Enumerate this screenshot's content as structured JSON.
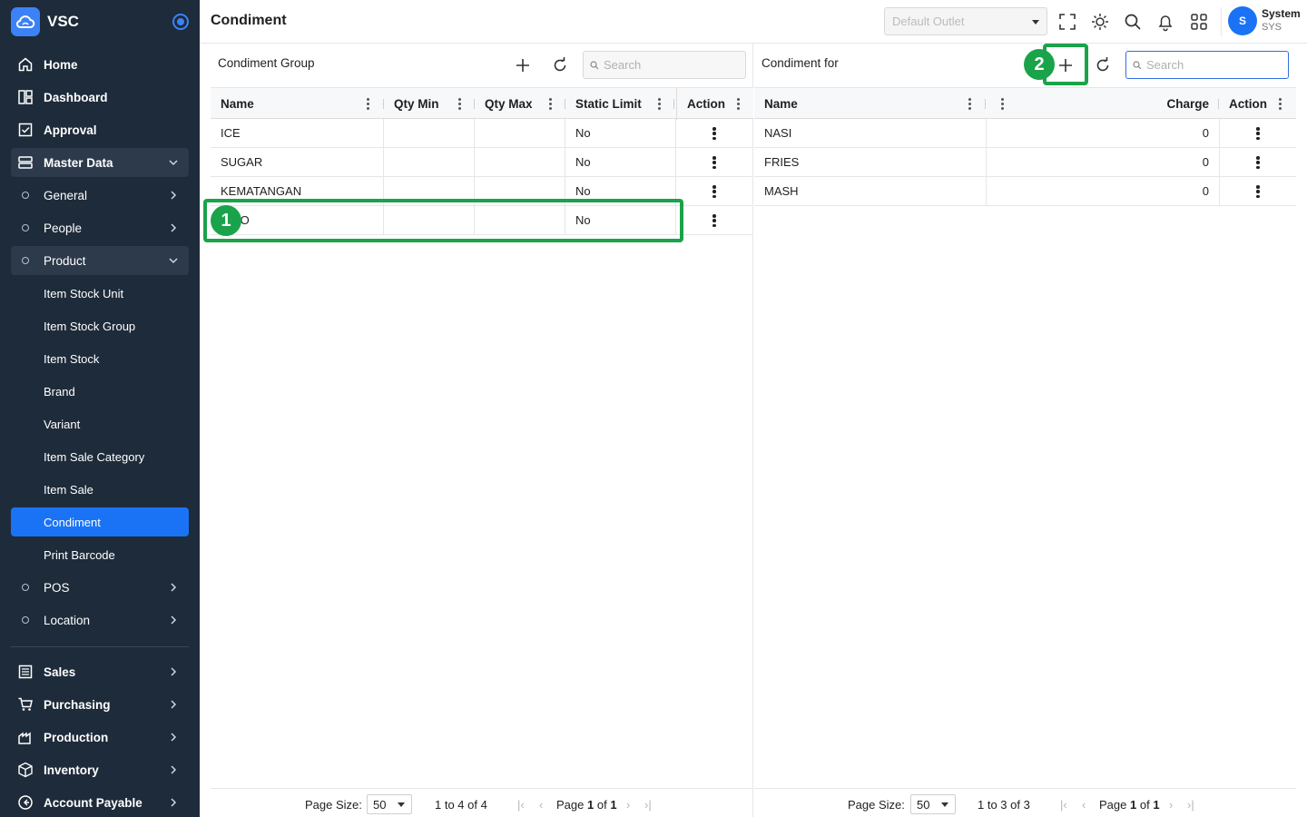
{
  "app": {
    "name": "VSC"
  },
  "sidebar": {
    "items": [
      {
        "label": "Home",
        "icon": "home-icon"
      },
      {
        "label": "Dashboard",
        "icon": "dashboard-icon"
      },
      {
        "label": "Approval",
        "icon": "approval-icon"
      },
      {
        "label": "Master Data",
        "icon": "master-data-icon"
      },
      {
        "label": "General"
      },
      {
        "label": "People"
      },
      {
        "label": "Product"
      },
      {
        "label": "Item Stock Unit"
      },
      {
        "label": "Item Stock Group"
      },
      {
        "label": "Item Stock"
      },
      {
        "label": "Brand"
      },
      {
        "label": "Variant"
      },
      {
        "label": "Item Sale Category"
      },
      {
        "label": "Item Sale"
      },
      {
        "label": "Condiment"
      },
      {
        "label": "Print Barcode"
      },
      {
        "label": "POS"
      },
      {
        "label": "Location"
      },
      {
        "label": "Sales",
        "icon": "sales-icon"
      },
      {
        "label": "Purchasing",
        "icon": "cart-icon"
      },
      {
        "label": "Production",
        "icon": "factory-icon"
      },
      {
        "label": "Inventory",
        "icon": "box-icon"
      },
      {
        "label": "Account Payable",
        "icon": "payable-icon"
      }
    ],
    "active": "Condiment"
  },
  "header": {
    "title": "Condiment",
    "outlet_placeholder": "Default Outlet",
    "user": {
      "initial": "S",
      "name": "System",
      "role": "SYS"
    }
  },
  "left_panel": {
    "title": "Condiment Group",
    "search_placeholder": "Search",
    "columns": [
      "Name",
      "Qty Min",
      "Qty Max",
      "Static Limit",
      "Action"
    ],
    "rows": [
      {
        "name": "ICE",
        "qty_min": "",
        "qty_max": "",
        "static_limit": "No"
      },
      {
        "name": "SUGAR",
        "qty_min": "",
        "qty_max": "",
        "static_limit": "No"
      },
      {
        "name": "KEMATANGAN",
        "qty_min": "",
        "qty_max": "",
        "static_limit": "No"
      },
      {
        "name": "BO",
        "qty_min": "",
        "qty_max": "",
        "static_limit": "No"
      }
    ],
    "pager": {
      "page_size_label": "Page Size:",
      "page_size": "50",
      "range": "1 to 4 of 4",
      "page_label": "Page",
      "page": "1",
      "of_label": "of",
      "pages": "1"
    }
  },
  "right_panel": {
    "title": "Condiment for",
    "search_placeholder": "Search",
    "columns": [
      "Name",
      "",
      "Charge",
      "Action"
    ],
    "rows": [
      {
        "name": "NASI",
        "charge": "0"
      },
      {
        "name": "FRIES",
        "charge": "0"
      },
      {
        "name": "MASH",
        "charge": "0"
      }
    ],
    "pager": {
      "page_size_label": "Page Size:",
      "page_size": "50",
      "range": "1 to 3 of 3",
      "page_label": "Page",
      "page": "1",
      "of_label": "of",
      "pages": "1"
    }
  },
  "annotations": [
    {
      "label": "1",
      "color": "#1aa34a"
    },
    {
      "label": "2",
      "color": "#1aa34a"
    }
  ],
  "colors": {
    "sidebar": "#1e2b3a",
    "accent": "#1a73f5",
    "annotation": "#1aa34a"
  }
}
